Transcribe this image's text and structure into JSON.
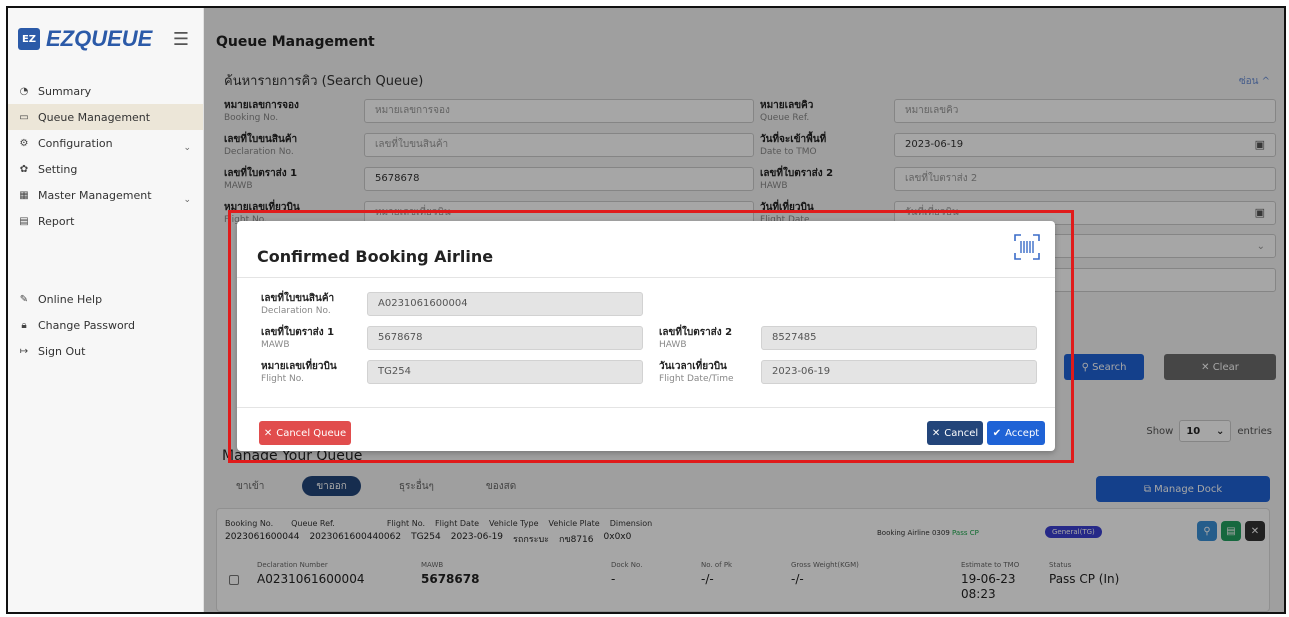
{
  "app": {
    "logo_badge": "EZ",
    "logo_text": "EZQUEUE",
    "menu_icon": "hamburger-icon"
  },
  "sidebar": {
    "items": [
      {
        "label": "Summary",
        "icon": "dashboard-icon"
      },
      {
        "label": "Queue Management",
        "icon": "queue-icon",
        "active": true
      },
      {
        "label": "Configuration",
        "icon": "config-icon",
        "has_children": true
      },
      {
        "label": "Setting",
        "icon": "gear-icon"
      },
      {
        "label": "Master Management",
        "icon": "table-icon",
        "has_children": true
      },
      {
        "label": "Report",
        "icon": "report-icon"
      }
    ],
    "bottom_items": [
      {
        "label": "Online Help",
        "icon": "pen-icon"
      },
      {
        "label": "Change Password",
        "icon": "lock-icon"
      },
      {
        "label": "Sign Out",
        "icon": "sign-out-icon"
      }
    ]
  },
  "page": {
    "title": "Queue Management"
  },
  "search": {
    "title": "ค้นหารายการคิว (Search Queue)",
    "hide_label": "ซ่อน ^",
    "fields": {
      "booking_no": {
        "th": "หมายเลขการจอง",
        "en": "Booking No.",
        "placeholder": "หมายเลขการจอง"
      },
      "queue_ref": {
        "th": "หมายเลขคิว",
        "en": "Queue Ref.",
        "placeholder": "หมายเลขคิว"
      },
      "declaration_no": {
        "th": "เลขที่ใบขนสินค้า",
        "en": "Declaration No.",
        "placeholder": "เลขที่ใบขนสินค้า"
      },
      "date_to_tmo": {
        "th": "วันที่จะเข้าพื้นที่",
        "en": "Date to TMO",
        "value": "2023-06-19"
      },
      "mawb": {
        "th": "เลขที่ใบตราส่ง 1",
        "en": "MAWB",
        "value": "5678678"
      },
      "hawb": {
        "th": "เลขที่ใบตราส่ง 2",
        "en": "HAWB",
        "placeholder": "เลขที่ใบตราส่ง 2"
      },
      "flight_no": {
        "th": "หมายเลขเที่ยวบิน",
        "en": "Flight No.",
        "placeholder": "หมายเลขเที่ยวบิน"
      },
      "flight_date": {
        "th": "วันที่เที่ยวบิน",
        "en": "Flight Date",
        "placeholder": "วันที่เที่ยวบิน"
      }
    },
    "search_button": "Search",
    "clear_button": "Clear"
  },
  "queue": {
    "title": "Manage Your Queue",
    "show_label": "Show",
    "entries_value": "10",
    "entries_label": "entries",
    "tabs": [
      {
        "label": "ขาเข้า",
        "active": false
      },
      {
        "label": "ขาออก",
        "active": true
      },
      {
        "label": "ธุระอื่นๆ",
        "active": false
      },
      {
        "label": "ของสด",
        "active": false
      }
    ],
    "manage_dock_button": "Manage Dock",
    "card": {
      "headers": [
        "Booking No.",
        "Queue Ref.",
        "Flight No.",
        "Flight Date",
        "Vehicle Type",
        "Vehicle Plate",
        "Dimension"
      ],
      "values": [
        "2023061600044",
        "2023061600440062",
        "TG254",
        "2023-06-19",
        "รถกระบะ",
        "กข8716",
        "0x0x0"
      ],
      "booking_airline_label": "Booking Airline",
      "booking_airline_value": "0309",
      "pass_cp": "Pass CP",
      "general_badge": "General(TG)",
      "detail": {
        "declaration_number": {
          "label": "Declaration Number",
          "value": "A0231061600004"
        },
        "mawb": {
          "label": "MAWB",
          "value": "5678678"
        },
        "dock_no": {
          "label": "Dock No.",
          "value": "-"
        },
        "no_of_pk": {
          "label": "No. of Pk",
          "value": "-/-"
        },
        "gross_weight": {
          "label": "Gross Weight(KGM)",
          "value": "-/-"
        },
        "estimate_to_tmo": {
          "label": "Estimate to TMO",
          "value": "19-06-23",
          "time": "08:23"
        },
        "status": {
          "label": "Status",
          "value": "Pass CP (In)"
        }
      }
    }
  },
  "modal": {
    "title": "Confirmed Booking Airline",
    "qr_icon": "barcode-scan-icon",
    "declaration": {
      "th": "เลขที่ใบขนสินค้า",
      "en": "Declaration No.",
      "value": "A0231061600004"
    },
    "mawb": {
      "th": "เลขที่ใบตราส่ง 1",
      "en": "MAWB",
      "value": "5678678"
    },
    "hawb": {
      "th": "เลขที่ใบตราส่ง 2",
      "en": "HAWB",
      "value": "8527485"
    },
    "flight_no": {
      "th": "หมายเลขเที่ยวบิน",
      "en": "Flight No.",
      "value": "TG254"
    },
    "flight_datetime": {
      "th": "วันเวลาเที่ยวบิน",
      "en": "Flight Date/Time",
      "value": "2023-06-19"
    },
    "cancel_queue_button": "Cancel Queue",
    "cancel_button": "Cancel",
    "accept_button": "Accept"
  },
  "colors": {
    "brand": "#2b5aa8",
    "danger": "#e14d4d",
    "navy": "#23457a",
    "primary": "#1f63d6",
    "highlight_box": "#e01b1b"
  }
}
